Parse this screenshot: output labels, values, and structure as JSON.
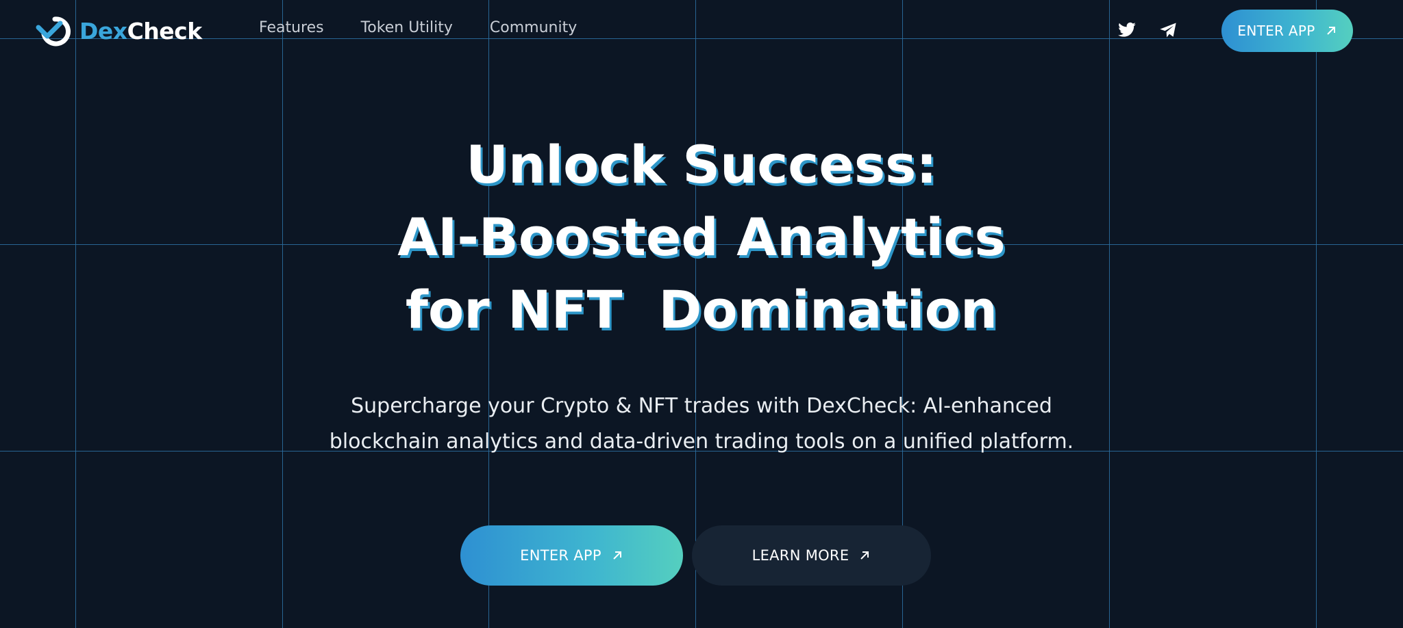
{
  "brand": {
    "name_part1": "Dex",
    "name_part2": "Check"
  },
  "nav": {
    "items": [
      {
        "label": "Features"
      },
      {
        "label": "Token Utility"
      },
      {
        "label": "Community"
      }
    ]
  },
  "social": {
    "twitter_icon": "twitter-icon",
    "telegram_icon": "telegram-icon"
  },
  "header_cta": {
    "label": "ENTER APP",
    "icon": "arrow-up-right-icon"
  },
  "hero": {
    "title_lines": [
      "Unlock Success:",
      "AI-Boosted Analytics",
      "for NFT  Domination"
    ],
    "subtitle_lines": [
      "Supercharge your Crypto & NFT trades with DexCheck: AI-enhanced",
      "blockchain analytics and data-driven trading tools on a unified platform."
    ],
    "primary_cta": "ENTER APP",
    "secondary_cta": "LEARN MORE"
  },
  "colors": {
    "background": "#0c1624",
    "accent": "#3aa6dc",
    "gradient_start": "#2e90d2",
    "gradient_end": "#55cfbf",
    "grid_lines": "#2b6ea0",
    "secondary_button": "#172434"
  }
}
